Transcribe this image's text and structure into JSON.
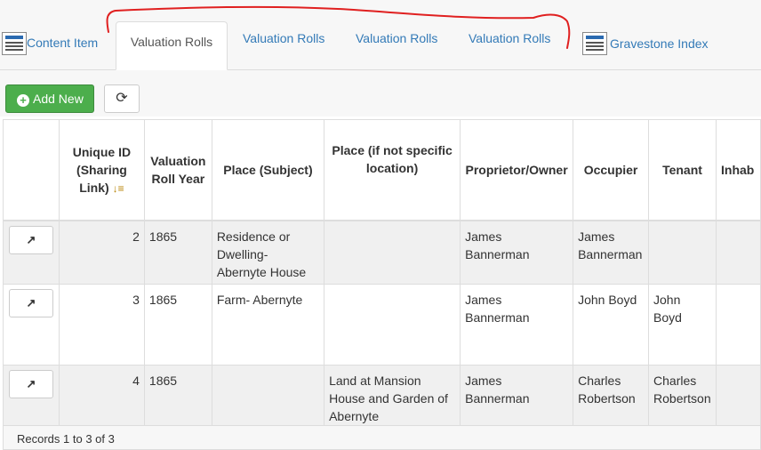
{
  "tabs": [
    {
      "label": "Content Item",
      "icon": "document-icon"
    },
    {
      "label": "Valuation Rolls",
      "active": true
    },
    {
      "label": "Valuation Rolls"
    },
    {
      "label": "Valuation Rolls"
    },
    {
      "label": "Valuation Rolls"
    },
    {
      "label": "Gravestone Index",
      "icon": "document-icon"
    }
  ],
  "toolbar": {
    "add_label": "Add New",
    "refresh_icon": "refresh-icon"
  },
  "table": {
    "headers": [
      "",
      "Unique ID (Sharing Link)",
      "Valuation Roll Year",
      "Place (Subject)",
      "Place (if not specific location)",
      "Proprietor/Owner",
      "Occupier",
      "Tenant",
      "Inhab"
    ],
    "rows": [
      {
        "id": "2",
        "year": "1865",
        "place": "Residence or Dwelling- Abernyte House",
        "place_other": "",
        "owner": "James Bannerman",
        "occupier": "James Bannerman",
        "tenant": "",
        "inhab": ""
      },
      {
        "id": "3",
        "year": "1865",
        "place": "Farm- Abernyte",
        "place_other": "",
        "owner": "James Bannerman",
        "occupier": "John Boyd",
        "tenant": "John Boyd",
        "inhab": ""
      },
      {
        "id": "4",
        "year": "1865",
        "place": "",
        "place_other": "Land at Mansion House and Garden of Abernyte",
        "owner": "James Bannerman",
        "occupier": "Charles Robertson",
        "tenant": "Charles Robertson",
        "inhab": ""
      }
    ]
  },
  "footer": {
    "records": "Records 1 to 3 of 3"
  },
  "colors": {
    "annotation": "#e02020",
    "primary_link": "#337ab7",
    "success": "#4cae4c"
  }
}
